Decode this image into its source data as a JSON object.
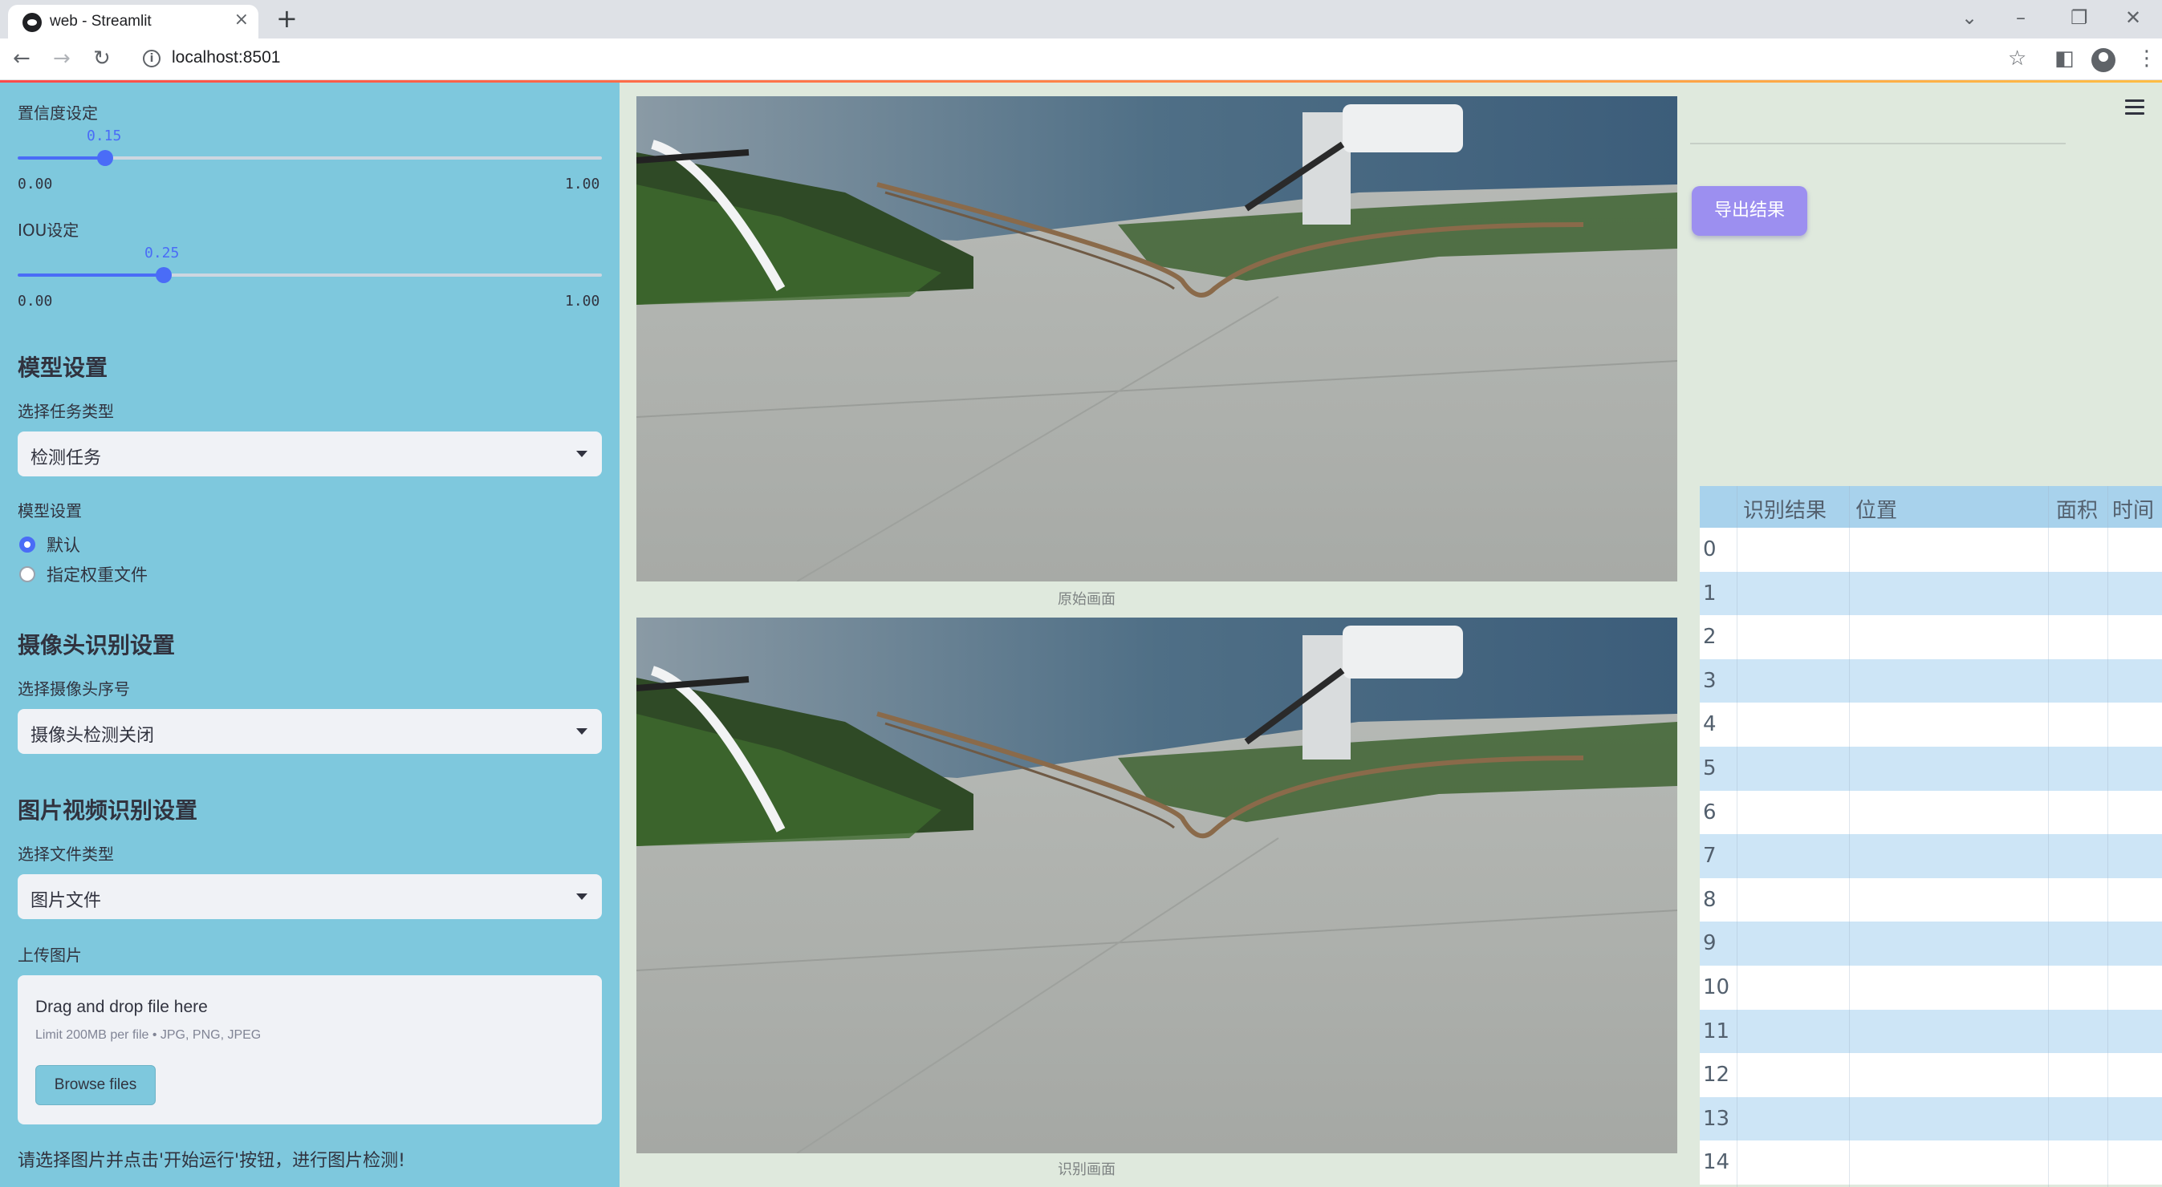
{
  "browser": {
    "tab_title": "web - Streamlit",
    "url": "localhost:8501"
  },
  "sidebar": {
    "confidence": {
      "label": "置信度设定",
      "value": "0.15",
      "value_fraction": 0.15,
      "min": "0.00",
      "max": "1.00"
    },
    "iou": {
      "label": "IOU设定",
      "value": "0.25",
      "value_fraction": 0.25,
      "min": "0.00",
      "max": "1.00"
    },
    "model_section": {
      "header": "模型设置",
      "task_label": "选择任务类型",
      "task_value": "检测任务",
      "model_label": "模型设置",
      "options": [
        "默认",
        "指定权重文件"
      ],
      "selected_option": "默认"
    },
    "camera_section": {
      "header": "摄像头识别设置",
      "camera_label": "选择摄像头序号",
      "camera_value": "摄像头检测关闭"
    },
    "media_section": {
      "header": "图片视频识别设置",
      "file_type_label": "选择文件类型",
      "file_type_value": "图片文件",
      "upload_label": "上传图片",
      "drop_text": "Drag and drop file here",
      "limit_text": "Limit 200MB per file • JPG, PNG, JPEG",
      "browse_label": "Browse files"
    },
    "footer_text": "请选择图片并点击'开始运行'按钮，进行图片检测!"
  },
  "main": {
    "original_caption": "原始画面",
    "result_caption": "识别画面",
    "export_label": "导出结果"
  },
  "table": {
    "columns": [
      "识别结果",
      "位置",
      "面积",
      "时间"
    ],
    "rows": [
      "0",
      "1",
      "2",
      "3",
      "4",
      "5",
      "6",
      "7",
      "8",
      "9",
      "10",
      "11",
      "12",
      "13",
      "14"
    ]
  },
  "colors": {
    "sidebar_bg": "#7ec8dd",
    "main_bg": "#dfe9dd",
    "accent": "#4a6cf7",
    "export_button": "#9c8ff0",
    "table_header": "#a8d2ec",
    "table_row_alt": "#cde5f6"
  }
}
